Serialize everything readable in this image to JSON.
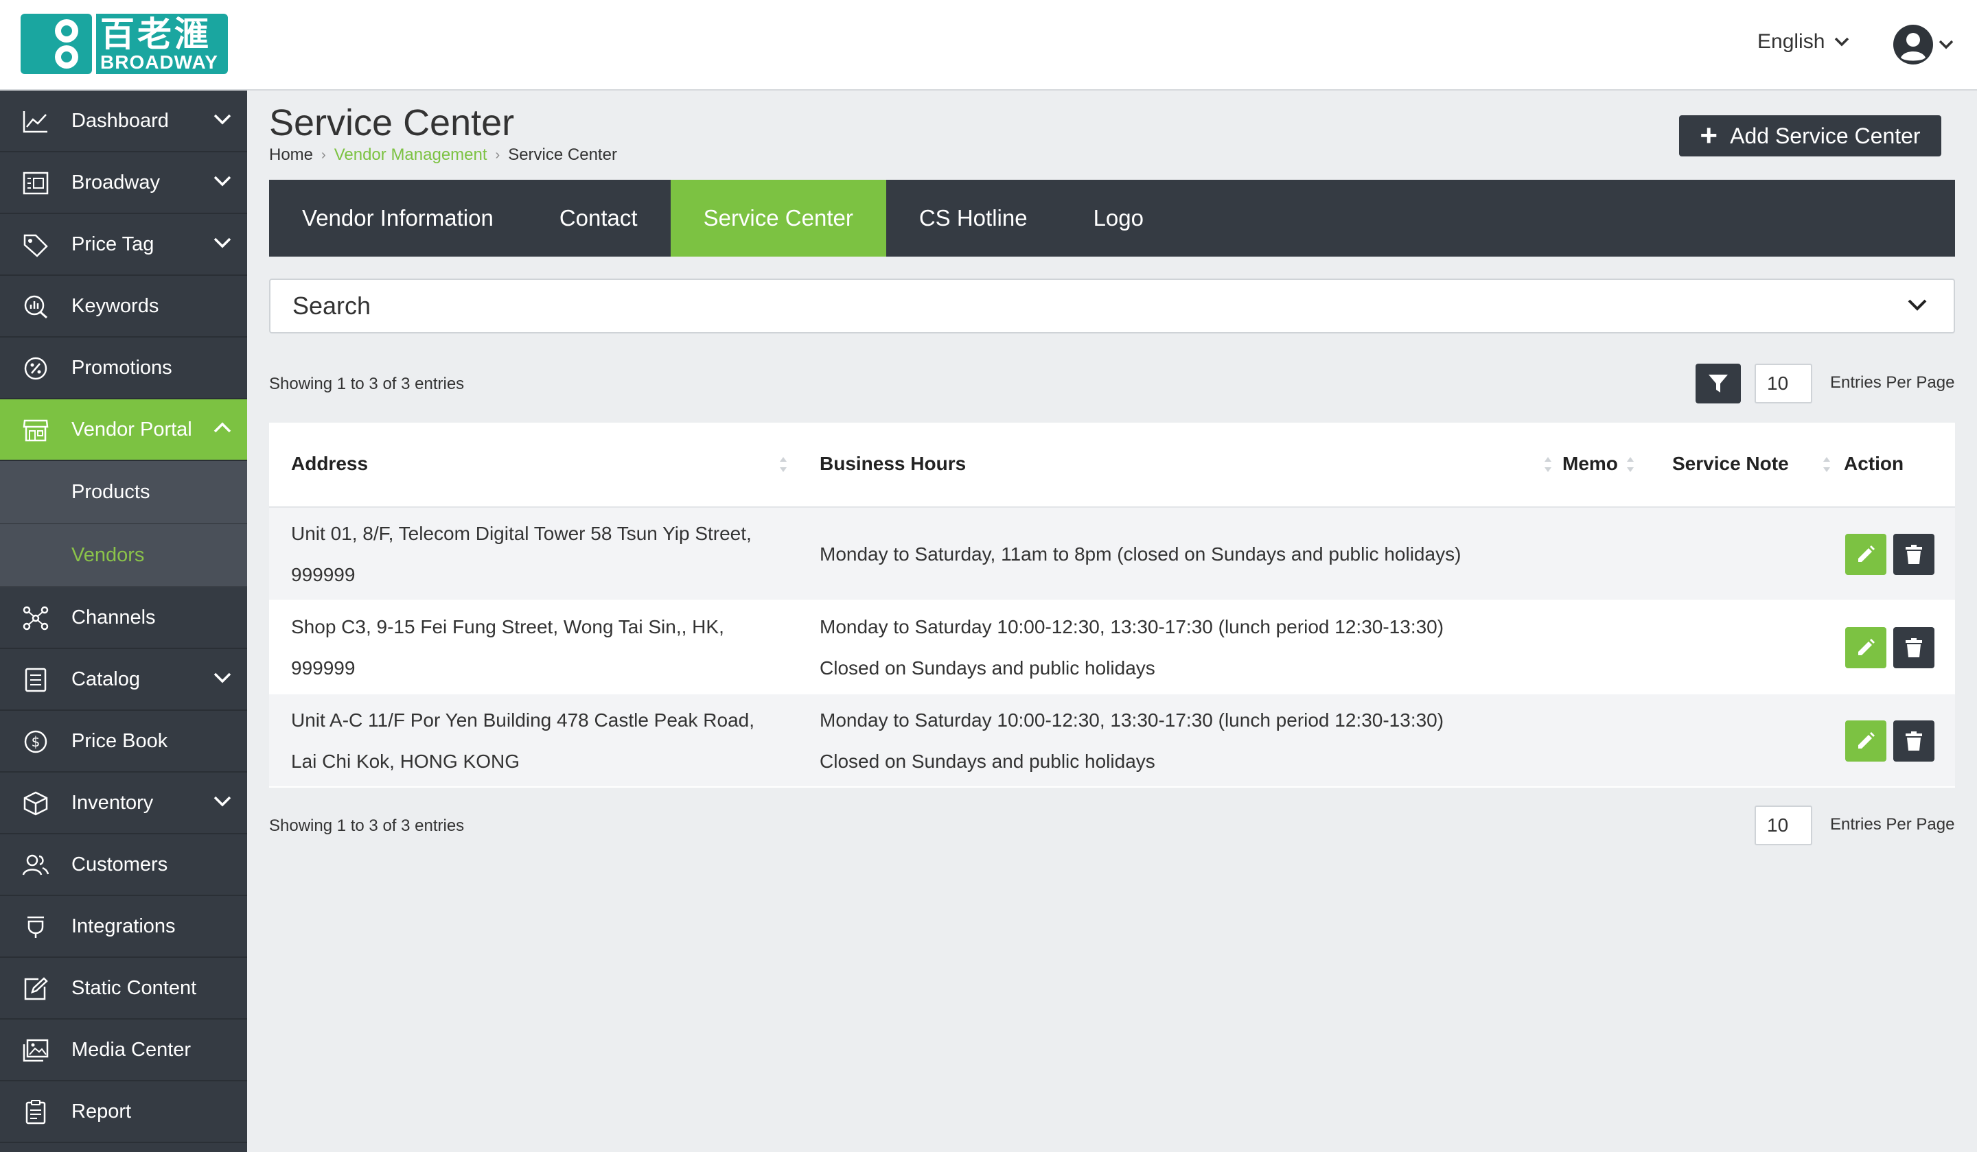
{
  "header": {
    "logo_cn": "百老滙",
    "logo_en": "BROADWAY",
    "language": "English"
  },
  "sidebar": {
    "items": [
      {
        "label": "Dashboard",
        "icon": "chart-line-icon"
      },
      {
        "label": "Broadway",
        "icon": "cash-register-icon"
      },
      {
        "label": "Price Tag",
        "icon": "tag-icon"
      },
      {
        "label": "Keywords",
        "icon": "search-chart-icon"
      },
      {
        "label": "Promotions",
        "icon": "percent-icon"
      },
      {
        "label": "Vendor Portal",
        "icon": "store-icon"
      },
      {
        "label": "Channels",
        "icon": "network-icon"
      },
      {
        "label": "Catalog",
        "icon": "list-icon"
      },
      {
        "label": "Price Book",
        "icon": "dollar-icon"
      },
      {
        "label": "Inventory",
        "icon": "box-icon"
      },
      {
        "label": "Customers",
        "icon": "users-icon"
      },
      {
        "label": "Integrations",
        "icon": "plug-icon"
      },
      {
        "label": "Static Content",
        "icon": "edit-icon"
      },
      {
        "label": "Media Center",
        "icon": "images-icon"
      },
      {
        "label": "Report",
        "icon": "clipboard-icon"
      }
    ],
    "sub_items": [
      {
        "label": "Products"
      },
      {
        "label": "Vendors"
      }
    ]
  },
  "page": {
    "title": "Service Center",
    "breadcrumb": [
      "Home",
      "Vendor Management",
      "Service Center"
    ],
    "add_button": "Add Service Center"
  },
  "tabs": [
    {
      "label": "Vendor Information"
    },
    {
      "label": "Contact"
    },
    {
      "label": "Service Center"
    },
    {
      "label": "CS Hotline"
    },
    {
      "label": "Logo"
    }
  ],
  "search": {
    "label": "Search"
  },
  "pagination": {
    "showing": "Showing 1 to 3 of 3 entries",
    "per_page_value": "10",
    "per_page_label": "Entries Per Page"
  },
  "table": {
    "columns": [
      "Address",
      "Business Hours",
      "Memo",
      "Service Note",
      "Action"
    ],
    "rows": [
      {
        "address": [
          "Unit 01, 8/F, Telecom Digital Tower 58 Tsun Yip Street,",
          "999999"
        ],
        "hours": [
          "Monday to Saturday, 11am to 8pm (closed on Sundays and public holidays)"
        ]
      },
      {
        "address": [
          "Shop C3, 9-15 Fei Fung Street, Wong Tai Sin,, HK,",
          "999999"
        ],
        "hours": [
          "Monday to Saturday 10:00-12:30, 13:30-17:30 (lunch period 12:30-13:30)",
          "Closed on Sundays and public holidays"
        ]
      },
      {
        "address": [
          "Unit A-C 11/F Por Yen Building 478 Castle Peak Road,",
          "Lai Chi Kok, HONG KONG"
        ],
        "hours": [
          "Monday to Saturday 10:00-12:30, 13:30-17:30 (lunch period 12:30-13:30)",
          "Closed on Sundays and public holidays"
        ]
      }
    ]
  },
  "colors": {
    "accent": "#7cc242",
    "dark": "#353b43",
    "background": "#eceef0"
  }
}
